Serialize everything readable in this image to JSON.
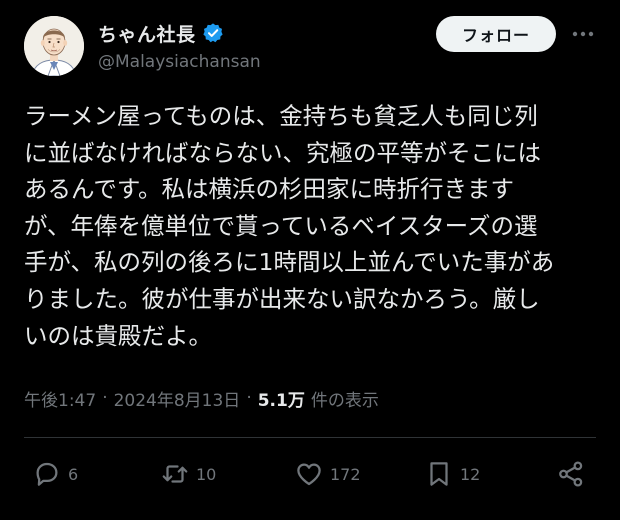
{
  "user": {
    "display_name": "ちゃん社長",
    "handle": "@Malaysiachansan",
    "avatar_icon": "avatar-illustration",
    "verified_icon": "verified-badge-icon",
    "verified_color": "#1d9bf0"
  },
  "follow_button": {
    "label": "フォロー"
  },
  "more_icon": "more-dots-icon",
  "tweet": {
    "lines": [
      "ラーメン屋ってものは、金持ちも貧乏人も同じ列",
      "に並ばなければならない、究極の平等がそこには",
      "あるんです。私は横浜の杉田家に時折行きます",
      "が、年俸を億単位で貰っているベイスターズの選",
      "手が、私の列の後ろに1時間以上並んでいた事があ",
      "りました。彼が仕事が出来ない訳なかろう。厳し",
      "いのは貴殿だよ。"
    ]
  },
  "meta": {
    "time": "午後1:47",
    "separator": "·",
    "date": "2024年8月13日",
    "views_count": "5.1万",
    "views_label": "件の表示"
  },
  "actions": {
    "replies": {
      "icon": "reply-icon",
      "count": "6"
    },
    "reposts": {
      "icon": "repost-icon",
      "count": "10"
    },
    "likes": {
      "icon": "heart-icon",
      "count": "172"
    },
    "bookmarks": {
      "icon": "bookmark-icon",
      "count": "12"
    },
    "share": {
      "icon": "share-icon"
    }
  },
  "colors": {
    "background": "#000000",
    "text_primary": "#e7e9ea",
    "text_secondary": "#71767b",
    "divider": "#2f3336",
    "button_bg": "#eff3f4"
  }
}
